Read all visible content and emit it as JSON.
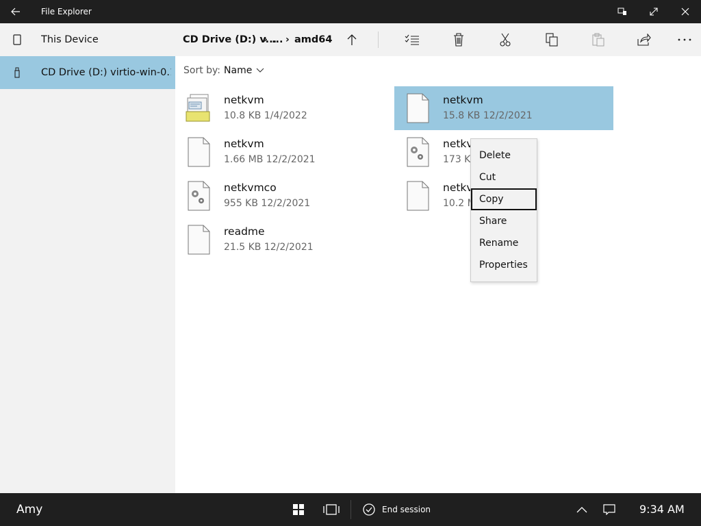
{
  "window": {
    "title": "File Explorer"
  },
  "sidebar": {
    "items": [
      {
        "label": "This Device",
        "icon": "device-icon"
      },
      {
        "label": "CD Drive (D:) virtio-win-0.1...",
        "icon": "usb-drive-icon"
      }
    ]
  },
  "breadcrumb": {
    "parts": [
      "CD Drive (D:) v...",
      "...",
      "amd64"
    ],
    "separator": "›"
  },
  "toolbar": {
    "actions": [
      "up-arrow-icon",
      "select-all-icon",
      "delete-icon",
      "cut-icon",
      "copy-icon",
      "paste-icon",
      "share-icon",
      "more-icon"
    ]
  },
  "sort": {
    "label": "Sort by:",
    "value": "Name"
  },
  "files": [
    {
      "name": "netkvm",
      "meta": "10.8 KB 1/4/2022",
      "icon": "setup-info-icon"
    },
    {
      "name": "netkvm",
      "meta": "15.8 KB 12/2/2021",
      "icon": "file-icon"
    },
    {
      "name": "netkvm",
      "meta": "1.66 MB 12/2/2021",
      "icon": "file-icon"
    },
    {
      "name": "netkv",
      "meta": "173 KB",
      "icon": "gear-file-icon"
    },
    {
      "name": "netkvmco",
      "meta": "955 KB 12/2/2021",
      "icon": "gear-file-icon"
    },
    {
      "name": "netkv",
      "meta": "10.2 M",
      "icon": "file-icon"
    },
    {
      "name": "readme",
      "meta": "21.5 KB 12/2/2021",
      "icon": "file-icon"
    }
  ],
  "context_menu": {
    "items": [
      "Delete",
      "Cut",
      "Copy",
      "Share",
      "Rename",
      "Properties"
    ]
  },
  "taskbar": {
    "user": "Amy",
    "end_session": "End session",
    "time": "9:34 AM"
  },
  "colors": {
    "selection": "#99c8e0",
    "chrome": "#1f1f1f",
    "pane": "#f2f2f2"
  }
}
